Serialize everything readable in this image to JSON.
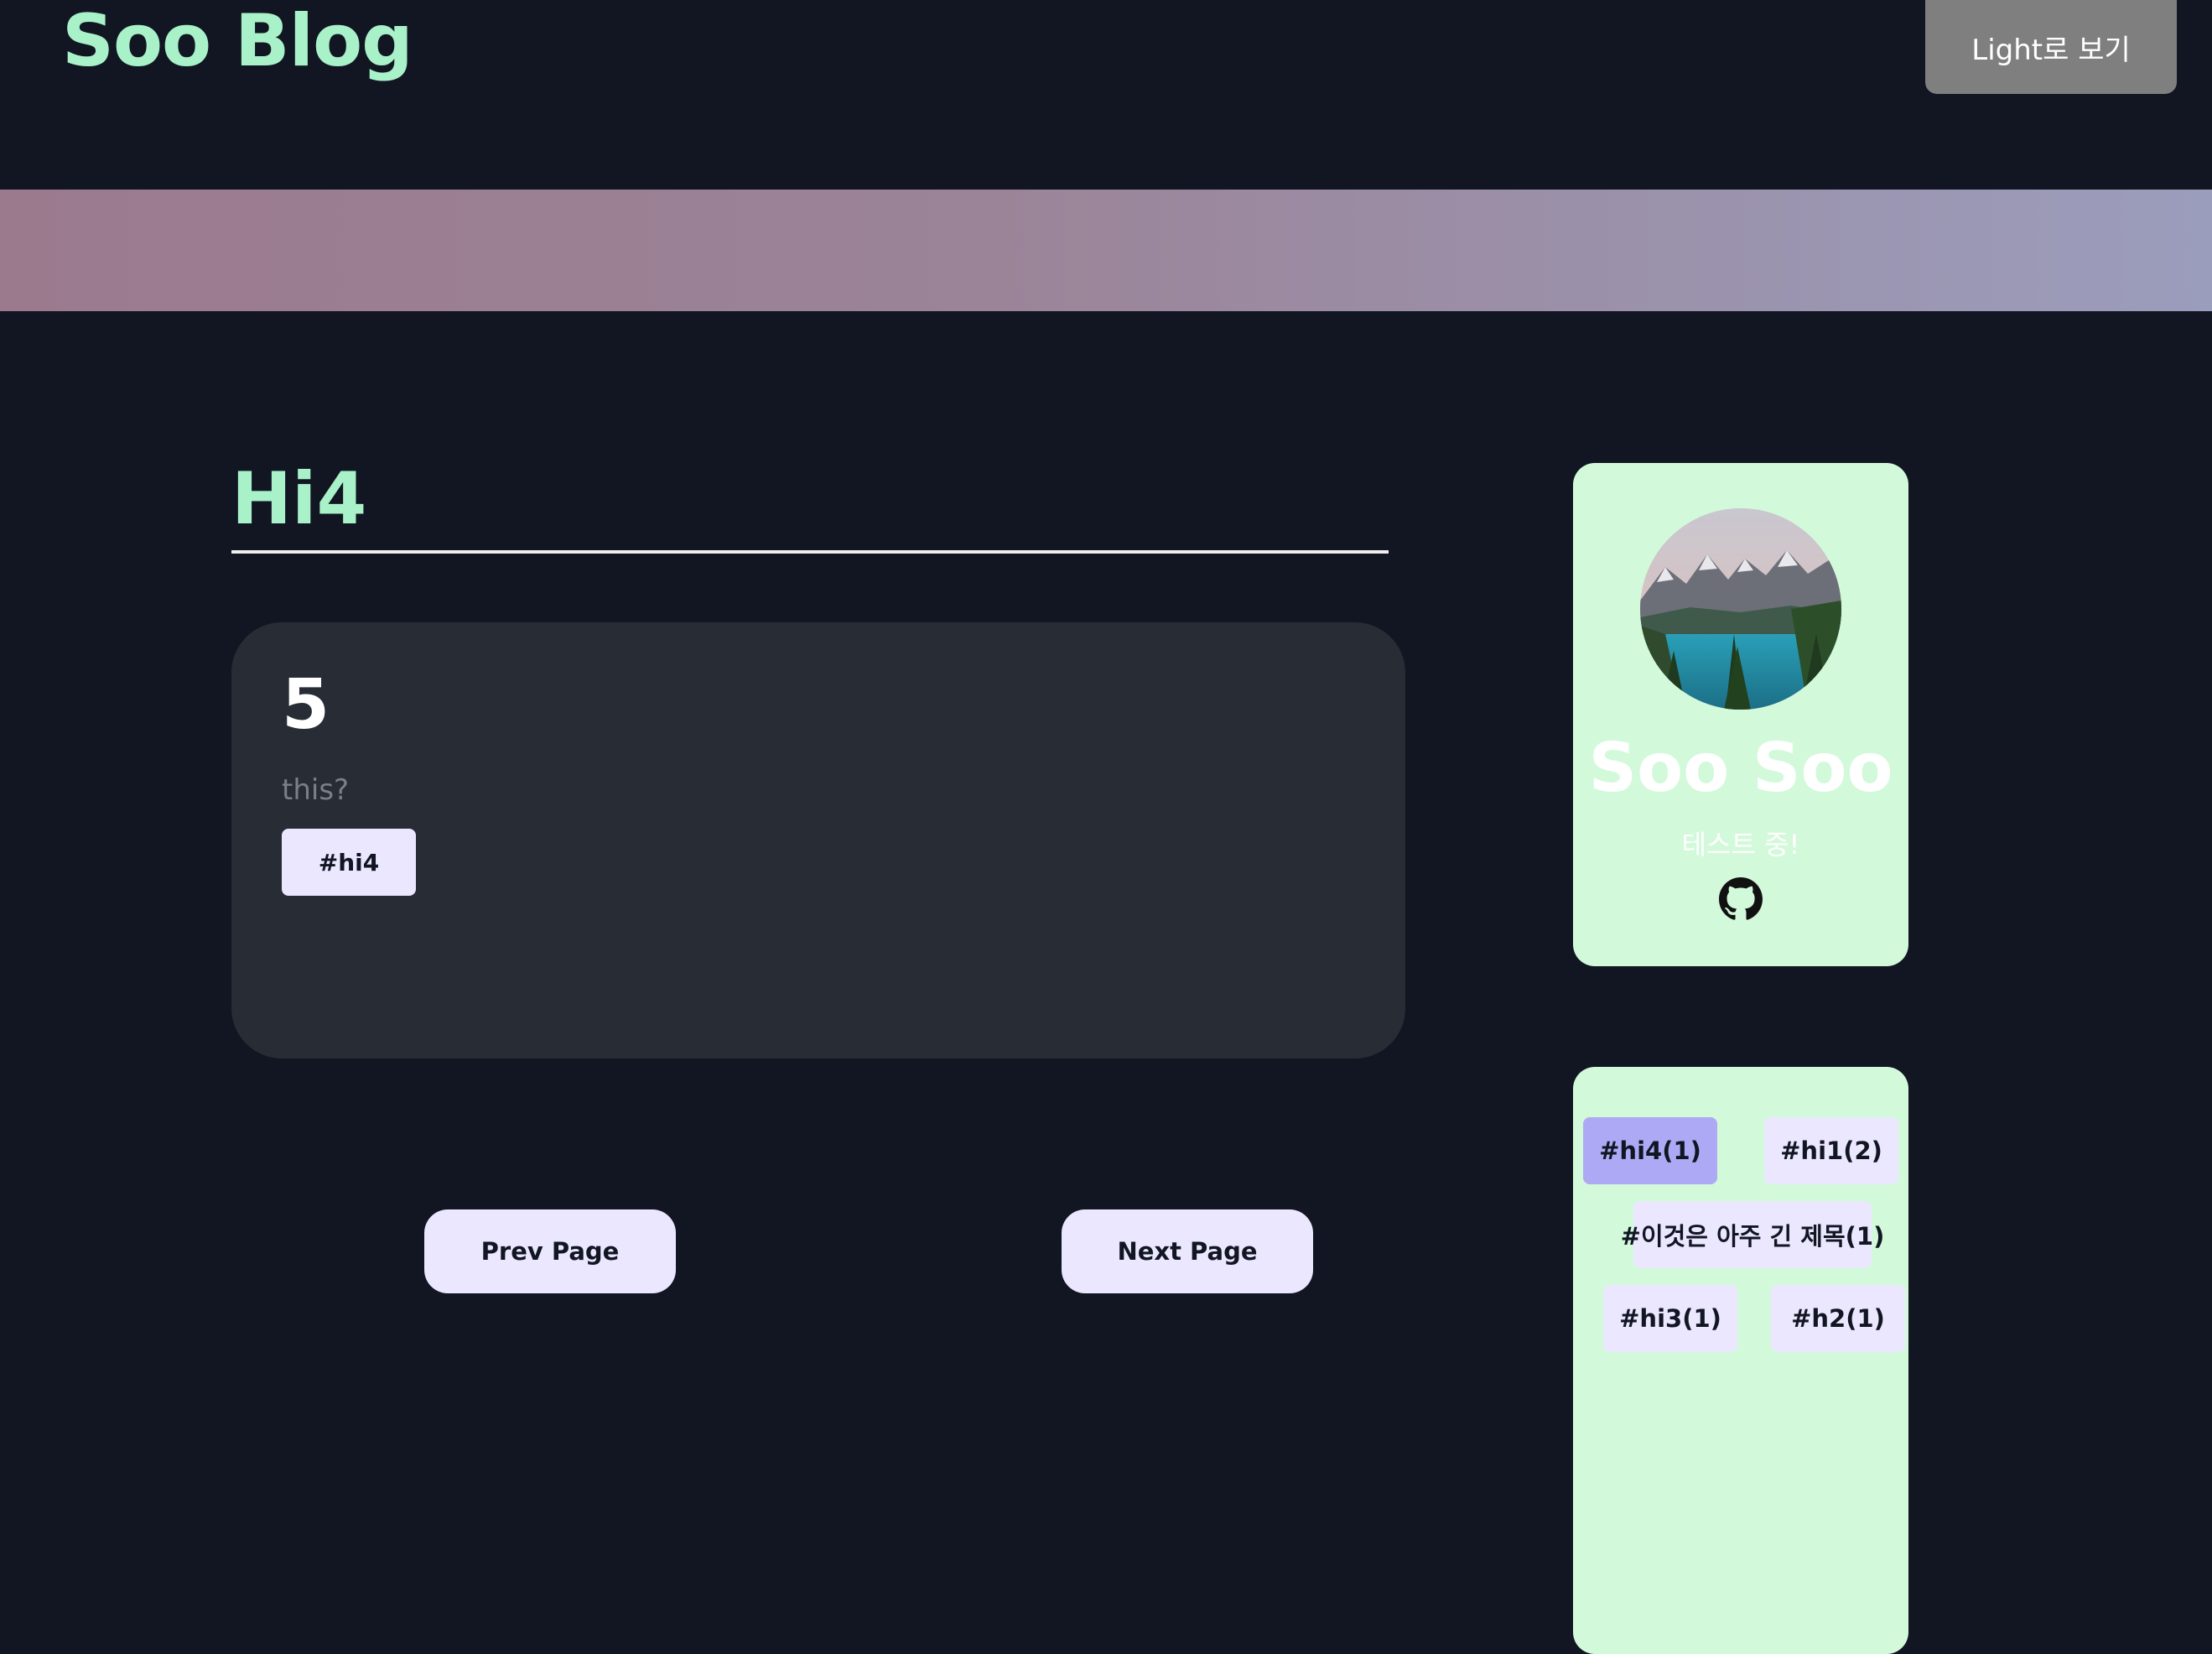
{
  "header": {
    "site_title": "Soo Blog",
    "theme_toggle_label": "Light로 보기"
  },
  "post": {
    "heading": "Hi4",
    "card": {
      "title": "5",
      "description": "this?",
      "tag": "#hi4"
    }
  },
  "pagination": {
    "prev_label": "Prev Page",
    "next_label": "Next Page"
  },
  "profile": {
    "name": "Soo Soo",
    "description": "테스트 중!",
    "avatar_alt": "mountain-lake-avatar",
    "link_icon": "github-icon"
  },
  "tags": [
    {
      "label": "#hi4(1)",
      "active": true
    },
    {
      "label": "#hi1(2)",
      "active": false
    },
    {
      "label": "#이것은 아주 긴 제목(1)",
      "active": false
    },
    {
      "label": "#hi3(1)",
      "active": false
    },
    {
      "label": "#h2(1)",
      "active": false
    }
  ],
  "colors": {
    "background": "#111622",
    "accent_green": "#a9f2c9",
    "card_dark": "#282c34",
    "card_mint": "#d3f9db",
    "button_lavender": "#ebe7ff",
    "tag_active": "#ada9f5"
  }
}
